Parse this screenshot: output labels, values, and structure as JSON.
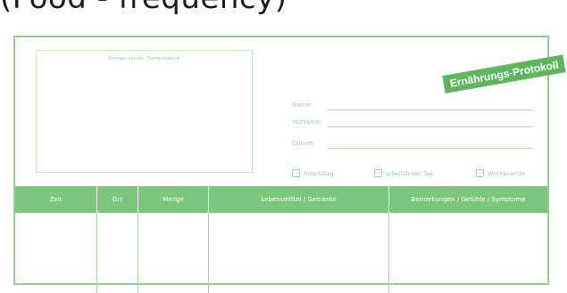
{
  "header": {
    "text": "(Food - frequency)"
  },
  "form": {
    "title": "Ernährungs-Protokoll",
    "stamp_label": "Stempel des/der Therapeuten/in",
    "fields": [
      {
        "label": "Name:"
      },
      {
        "label": "Vorname:"
      },
      {
        "label": "Datum:"
      }
    ],
    "checkboxes": [
      {
        "label": "Arbeitstag",
        "checked": false
      },
      {
        "label": "arbeitsfreier Tag",
        "checked": false
      },
      {
        "label": "Wochenende",
        "checked": false
      }
    ],
    "table": {
      "columns": [
        "Zeit",
        "Ort",
        "Menge",
        "Lebensmittel / Getränke",
        "Bemerkungen / Gefühle / Symptome"
      ]
    }
  },
  "colors": {
    "accent": "#7dc67d",
    "border": "#8fcf8f",
    "text_light": "#9dcc9d"
  }
}
